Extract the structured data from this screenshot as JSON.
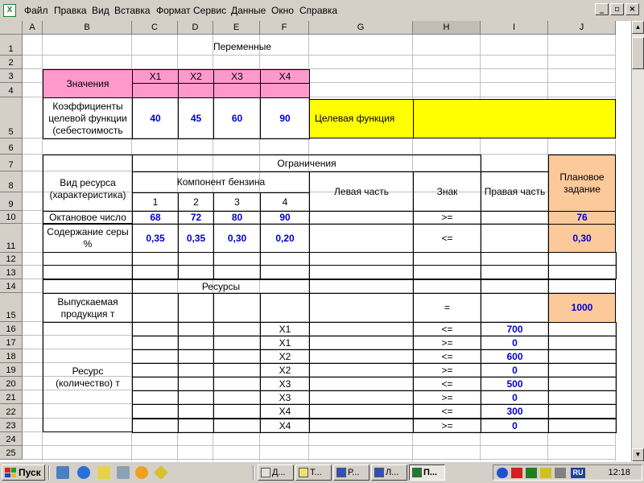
{
  "menu": {
    "app_icon": "X",
    "items": [
      "Файл",
      "Правка",
      "Вид",
      "Вставка",
      "Формат",
      "Сервис",
      "Данные",
      "Окно",
      "Справка"
    ]
  },
  "window_controls": {
    "minimize": "_",
    "restore": "▫",
    "close": "×"
  },
  "sheet": {
    "columns": [
      "A",
      "B",
      "C",
      "D",
      "E",
      "F",
      "G",
      "H",
      "I",
      "J"
    ],
    "selected_column": "H",
    "rows": [
      "1",
      "2",
      "3",
      "4",
      "5",
      "6",
      "7",
      "8",
      "9",
      "10",
      "11",
      "12",
      "13",
      "14",
      "15",
      "16",
      "17",
      "18",
      "19",
      "20",
      "21",
      "22",
      "23",
      "24",
      "25"
    ],
    "variables_title": "Переменные",
    "values_label": "Значения",
    "var_names": [
      "X1",
      "X2",
      "X3",
      "X4"
    ],
    "coef_label": "Коэффициенты целевой функции (себестоимость",
    "coef_values": [
      "40",
      "45",
      "60",
      "90"
    ],
    "objective_label": "Целевая функция",
    "constraints_title": "Ограничения",
    "resource_type_label": "Вид ресурса (характеристика)",
    "component_label": "Компонент бензина",
    "component_numbers": [
      "1",
      "2",
      "3",
      "4"
    ],
    "left_part_label": "Левая часть",
    "sign_label": "Знак",
    "right_part_label": "Правая часть",
    "plan_label": "Плановое задание",
    "octane_label": "Октановое число",
    "octane_values": [
      "68",
      "72",
      "80",
      "90"
    ],
    "octane_sign": ">=",
    "octane_plan": "76",
    "sulfur_label": "Содержание серы %",
    "sulfur_values": [
      "0,35",
      "0,35",
      "0,30",
      "0,20"
    ],
    "sulfur_sign": "<=",
    "sulfur_plan": "0,30",
    "resources_title": "Ресурсы",
    "output_label": "Выпускаемая продукция т",
    "output_sign": "=",
    "output_plan": "1000",
    "resource_qty_label": "Ресурс (количество) т",
    "resource_rows": [
      {
        "var": "X1",
        "sign": "<=",
        "value": "700"
      },
      {
        "var": "X1",
        "sign": ">=",
        "value": "0"
      },
      {
        "var": "X2",
        "sign": "<=",
        "value": "600"
      },
      {
        "var": "X2",
        "sign": ">=",
        "value": "0"
      },
      {
        "var": "X3",
        "sign": "<=",
        "value": "500"
      },
      {
        "var": "X3",
        "sign": ">=",
        "value": "0"
      },
      {
        "var": "X4",
        "sign": "<=",
        "value": "300"
      },
      {
        "var": "X4",
        "sign": ">=",
        "value": "0"
      }
    ]
  },
  "taskbar": {
    "start_label": "Пуск",
    "tasks": [
      "Д...",
      "Т...",
      "Р...",
      "Л...",
      "П..."
    ],
    "tray_lang": "RU",
    "clock": "12:18"
  },
  "colors": {
    "pink": "#ff99cc",
    "yellow": "#ffff00",
    "orange": "#fcc99b",
    "value_blue": "#0000cc"
  }
}
